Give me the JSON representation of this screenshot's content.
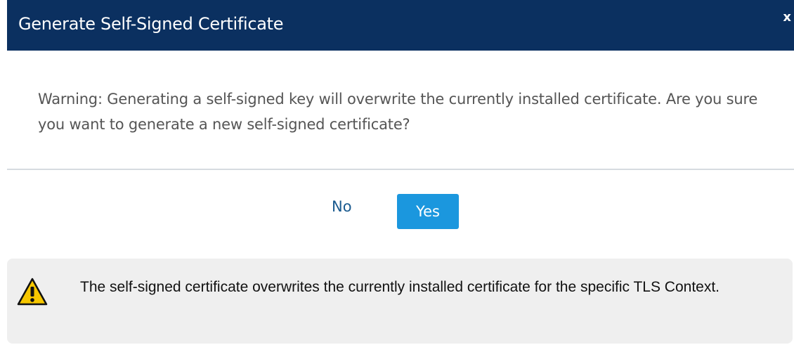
{
  "dialog": {
    "title": "Generate Self-Signed Certificate",
    "close_label": "x",
    "message": "Warning: Generating a self-signed key will overwrite the currently installed certificate. Are you sure you want to generate a new self-signed certificate?",
    "no_label": "No",
    "yes_label": "Yes"
  },
  "note": {
    "icon": "warning-icon",
    "text": "The self-signed certificate overwrites the currently installed certificate for the specific TLS Context."
  },
  "colors": {
    "header_bg": "#0b3060",
    "yes_button_bg": "#1b97de",
    "no_button_text": "#1a5a8f",
    "note_bg": "#efefef",
    "warning_fill": "#f7c700"
  }
}
